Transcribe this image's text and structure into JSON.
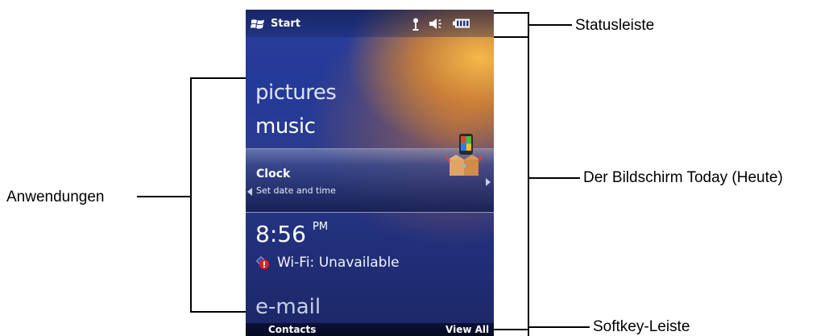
{
  "annotations": {
    "statusleiste": "Statusleiste",
    "anwendungen": "Anwendungen",
    "today_screen": "Der Bildschirm Today (Heute)",
    "softkey_leiste": "Softkey-Leiste"
  },
  "status_bar": {
    "start_label": "Start",
    "icons": [
      "windows-logo-icon",
      "antenna-icon",
      "speaker-muted-icon",
      "battery-icon"
    ]
  },
  "apps": {
    "pictures": "pictures",
    "music": "music",
    "email": "e-mail"
  },
  "clock_item": {
    "title": "Clock",
    "subtitle": "Set date and time"
  },
  "time": {
    "value": "8:56",
    "ampm": "PM"
  },
  "wifi": {
    "label": "Wi-Fi: Unavailable"
  },
  "softkeys": {
    "left": "Contacts",
    "right": "View All"
  }
}
